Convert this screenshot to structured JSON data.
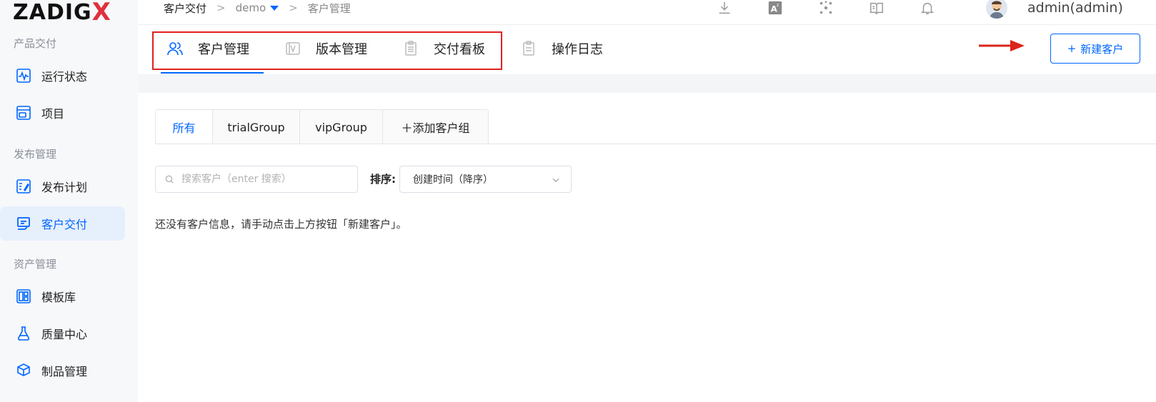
{
  "app": {
    "logo_main": "ZADIG",
    "logo_x": "X"
  },
  "sidebar": {
    "sections": [
      {
        "title": "产品交付"
      },
      {
        "title": "发布管理"
      },
      {
        "title": "资产管理"
      }
    ],
    "items": [
      {
        "label": "运行状态",
        "icon": "pulse-icon"
      },
      {
        "label": "项目",
        "icon": "project-icon"
      },
      {
        "label": "发布计划",
        "icon": "release-plan-icon"
      },
      {
        "label": "客户交付",
        "icon": "delivery-icon",
        "active": true
      },
      {
        "label": "模板库",
        "icon": "template-icon"
      },
      {
        "label": "质量中心",
        "icon": "flask-icon"
      },
      {
        "label": "制品管理",
        "icon": "artifact-icon"
      }
    ]
  },
  "header": {
    "breadcrumb": {
      "root": "客户交付",
      "sep1": ">",
      "project": "demo",
      "sep2": ">",
      "current": "客户管理"
    },
    "icons": [
      "download-icon",
      "translate-icon",
      "plugin-icon",
      "docs-icon",
      "bell-icon"
    ],
    "user": "admin(admin)"
  },
  "tabs": {
    "items": [
      {
        "label": "客户管理",
        "icon": "customers-icon",
        "active": true
      },
      {
        "label": "版本管理",
        "icon": "version-icon"
      },
      {
        "label": "交付看板",
        "icon": "board-icon"
      },
      {
        "label": "操作日志",
        "icon": "log-icon"
      }
    ],
    "new_button": "新建客户",
    "new_button_plus": "+"
  },
  "groups": {
    "items": [
      {
        "label": "所有",
        "active": true
      },
      {
        "label": "trialGroup"
      },
      {
        "label": "vipGroup"
      },
      {
        "label": "＋添加客户组"
      }
    ]
  },
  "filters": {
    "search_placeholder": "搜索客户（enter 搜索）",
    "sort_label": "排序:",
    "sort_value": "创建时间（降序）"
  },
  "empty_message": "还没有客户信息，请手动点击上方按钮「新建客户」。",
  "colors": {
    "accent": "#0066ff",
    "highlight": "#e02020",
    "arrow": "#d9251c"
  }
}
